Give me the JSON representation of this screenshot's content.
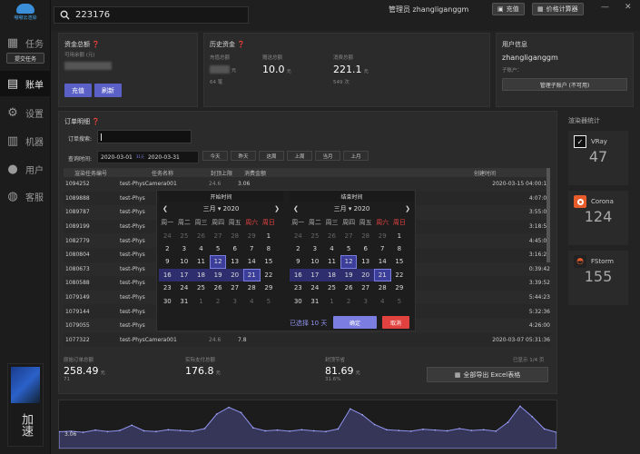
{
  "app": {
    "logo_text": "嘟嘟云渲染",
    "accelerate": "加速"
  },
  "search": {
    "value": "223176"
  },
  "nav": [
    {
      "label": "任务",
      "icon": "tasks-icon"
    },
    {
      "label": "账单",
      "icon": "bill-icon"
    },
    {
      "label": "设置",
      "icon": "gear-icon"
    },
    {
      "label": "机器",
      "icon": "machine-icon"
    },
    {
      "label": "用户",
      "icon": "user-icon"
    },
    {
      "label": "客服",
      "icon": "support-icon"
    }
  ],
  "submit_task": "提交任务",
  "topbar": {
    "admin": "管理员 zhangliganggm",
    "recharge": "充值",
    "price_calc": "价格计算器",
    "minimize": "—",
    "close": "✕"
  },
  "funds": {
    "title": "资金总额",
    "available_label": "可用余额 (元)",
    "recharge": "充值",
    "refresh": "刷新"
  },
  "history": {
    "title": "历史资金",
    "recharge_total_label": "充值总额",
    "recharge_total_unit": "元",
    "recharge_count": "64",
    "recharge_count_unit": "笔",
    "gift_total_label": "赠送总额",
    "gift_total_value": "10.0",
    "gift_total_unit": "元",
    "consume_total_label": "消费总额",
    "consume_total_value": "221.1",
    "consume_total_unit": "元",
    "consume_count": "549",
    "consume_count_unit": "次"
  },
  "user": {
    "title": "用户信息",
    "name": "zhangliganggm",
    "sub_label": "子账户：",
    "manage": "管理子账户 (不可用)"
  },
  "orders": {
    "title": "订单明细",
    "search_label": "订单搜索:",
    "query_label": "查询时间:",
    "date_from": "2020-03-01",
    "date_sep": "31天",
    "date_to": "2020-03-31",
    "quick": [
      "今天",
      "昨天",
      "这周",
      "上周",
      "当月",
      "上月"
    ],
    "columns": [
      "渲染任务编号",
      "任务名称",
      "封顶上限",
      "消费金额",
      "",
      "创建时间"
    ],
    "rows": [
      [
        "1094252",
        "test-PhysCamera001",
        "24.6",
        "3.06",
        "",
        "2020-03-15 04:00:16"
      ],
      [
        "1089888",
        "test-Phys",
        "",
        "",
        "",
        "4:07:07"
      ],
      [
        "1089787",
        "test-Phys",
        "",
        "",
        "",
        "3:55:03"
      ],
      [
        "1089199",
        "test-Phys",
        "",
        "",
        "",
        "3:18:52"
      ],
      [
        "1082779",
        "test-Phys",
        "",
        "",
        "",
        "4:45:04"
      ],
      [
        "1080804",
        "test-Phys",
        "",
        "",
        "",
        "3:16:27"
      ],
      [
        "1080673",
        "test-Phys",
        "",
        "",
        "",
        "0:39:42"
      ],
      [
        "1080588",
        "test-Phys",
        "",
        "",
        "",
        "3:39:52"
      ],
      [
        "1079149",
        "test-Phys",
        "",
        "",
        "",
        "5:44:23"
      ],
      [
        "1079144",
        "test-Phys",
        "",
        "",
        "",
        "5:32:36"
      ],
      [
        "1079055",
        "test-Phys",
        "",
        "",
        "",
        "4:26:00"
      ],
      [
        "1077322",
        "test-PhysCamera001",
        "24.6",
        "7.8",
        "",
        "2020-03-07 05:31:36"
      ]
    ],
    "shown": "已显示 1/4 页",
    "export": "全部导出 Excel表格"
  },
  "calendar": {
    "start_title": "开始时间",
    "end_title": "结束时间",
    "month": "三月",
    "year": "2020",
    "weekdays": [
      "周一",
      "周二",
      "周三",
      "周四",
      "周五",
      "周六",
      "周日"
    ],
    "selected_text": "已选择 10 天",
    "confirm": "确定",
    "cancel": "取消",
    "weeks": [
      [
        [
          "24",
          "o"
        ],
        [
          "25",
          "o"
        ],
        [
          "26",
          "o"
        ],
        [
          "27",
          "o"
        ],
        [
          "28",
          "o"
        ],
        [
          "29",
          "o"
        ],
        [
          "1",
          ""
        ]
      ],
      [
        [
          "2",
          ""
        ],
        [
          "3",
          ""
        ],
        [
          "4",
          ""
        ],
        [
          "5",
          ""
        ],
        [
          "6",
          ""
        ],
        [
          "7",
          ""
        ],
        [
          "8",
          ""
        ]
      ],
      [
        [
          "9",
          ""
        ],
        [
          "10",
          ""
        ],
        [
          "11",
          ""
        ],
        [
          "12",
          "sel"
        ],
        [
          "13",
          ""
        ],
        [
          "14",
          ""
        ],
        [
          "15",
          ""
        ]
      ],
      [
        [
          "16",
          "r"
        ],
        [
          "17",
          "r"
        ],
        [
          "18",
          "r"
        ],
        [
          "19",
          "r"
        ],
        [
          "20",
          "r"
        ],
        [
          "21",
          "sel"
        ],
        [
          "22",
          ""
        ]
      ],
      [
        [
          "23",
          ""
        ],
        [
          "24",
          ""
        ],
        [
          "25",
          ""
        ],
        [
          "26",
          ""
        ],
        [
          "27",
          ""
        ],
        [
          "28",
          ""
        ],
        [
          "29",
          ""
        ]
      ],
      [
        [
          "30",
          ""
        ],
        [
          "31",
          ""
        ],
        [
          "1",
          "o"
        ],
        [
          "2",
          "o"
        ],
        [
          "3",
          "o"
        ],
        [
          "4",
          "o"
        ],
        [
          "5",
          "o"
        ]
      ]
    ]
  },
  "totals": {
    "orig_label": "原始订单总额",
    "orig_value": "258.49",
    "orig_unit": "元",
    "orig_count": "71",
    "actual_label": "实际支付总额",
    "actual_value": "176.8",
    "actual_unit": "元",
    "save_label": "封顶节省",
    "save_value": "81.69",
    "save_unit": "元",
    "save_pct": "31.6%"
  },
  "renderers": {
    "title": "渲染器统计",
    "items": [
      {
        "name": "VRay",
        "count": "47"
      },
      {
        "name": "Corona",
        "count": "124"
      },
      {
        "name": "FStorm",
        "count": "155"
      }
    ]
  },
  "graph": {
    "label": "3.06",
    "values": [
      3.06,
      3.2,
      2.9,
      3.5,
      3.1,
      3.4,
      4.8,
      3.3,
      3.1,
      3.6,
      3.4,
      3.2,
      3.9,
      7.8,
      9.6,
      8.2,
      4.1,
      3.3,
      3.5,
      3.2,
      3.6,
      3.3,
      3.1,
      3.8,
      9.2,
      7.6,
      5.0,
      3.6,
      3.4,
      3.2,
      3.7,
      3.5,
      3.3,
      3.9,
      3.4,
      3.6,
      3.2,
      5.6,
      9.9,
      7.1,
      3.8,
      2.9
    ]
  }
}
